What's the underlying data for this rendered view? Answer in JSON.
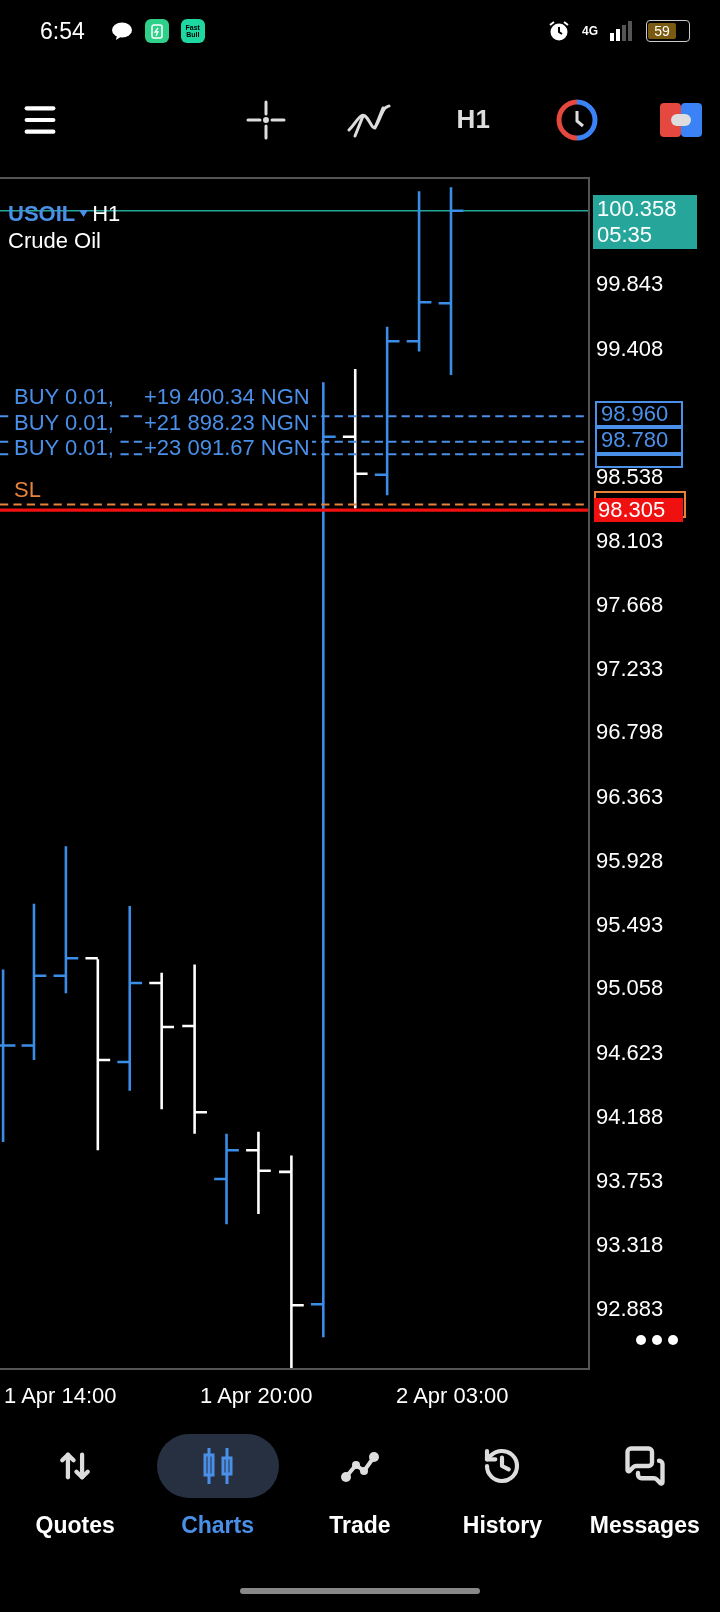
{
  "status_bar": {
    "time": "6:54",
    "app_label": "Fast Bull",
    "network": "4G",
    "battery": "59"
  },
  "toolbar": {
    "timeframe": "H1"
  },
  "chart": {
    "symbol": "USOIL",
    "timeframe": "H1",
    "description": "Crude Oil",
    "current_price": {
      "price": "100.358",
      "countdown": "05:35"
    },
    "price_labels": [
      "99.843",
      "99.408",
      "98.538",
      "98.103",
      "97.668",
      "97.233",
      "96.798",
      "96.363",
      "95.928",
      "95.493",
      "95.058",
      "94.623",
      "94.188",
      "93.753",
      "93.318",
      "92.883"
    ],
    "orders": [
      {
        "label": "BUY 0.01,",
        "profit": "+19 400.34 NGN",
        "price": "98.960"
      },
      {
        "label": "BUY 0.01,",
        "profit": "+21 898.23 NGN",
        "price": "98.780"
      },
      {
        "label": "BUY 0.01,",
        "profit": "+23 091.67 NGN"
      }
    ],
    "stop_loss": {
      "label": "SL"
    },
    "last_price": {
      "price": "98.305"
    },
    "time_labels": [
      "1 Apr 14:00",
      "1 Apr 20:00",
      "2 Apr 03:00"
    ]
  },
  "nav": [
    {
      "label": "Quotes",
      "selected": false
    },
    {
      "label": "Charts",
      "selected": true
    },
    {
      "label": "Trade",
      "selected": false
    },
    {
      "label": "History",
      "selected": false
    },
    {
      "label": "Messages",
      "selected": false
    }
  ]
}
